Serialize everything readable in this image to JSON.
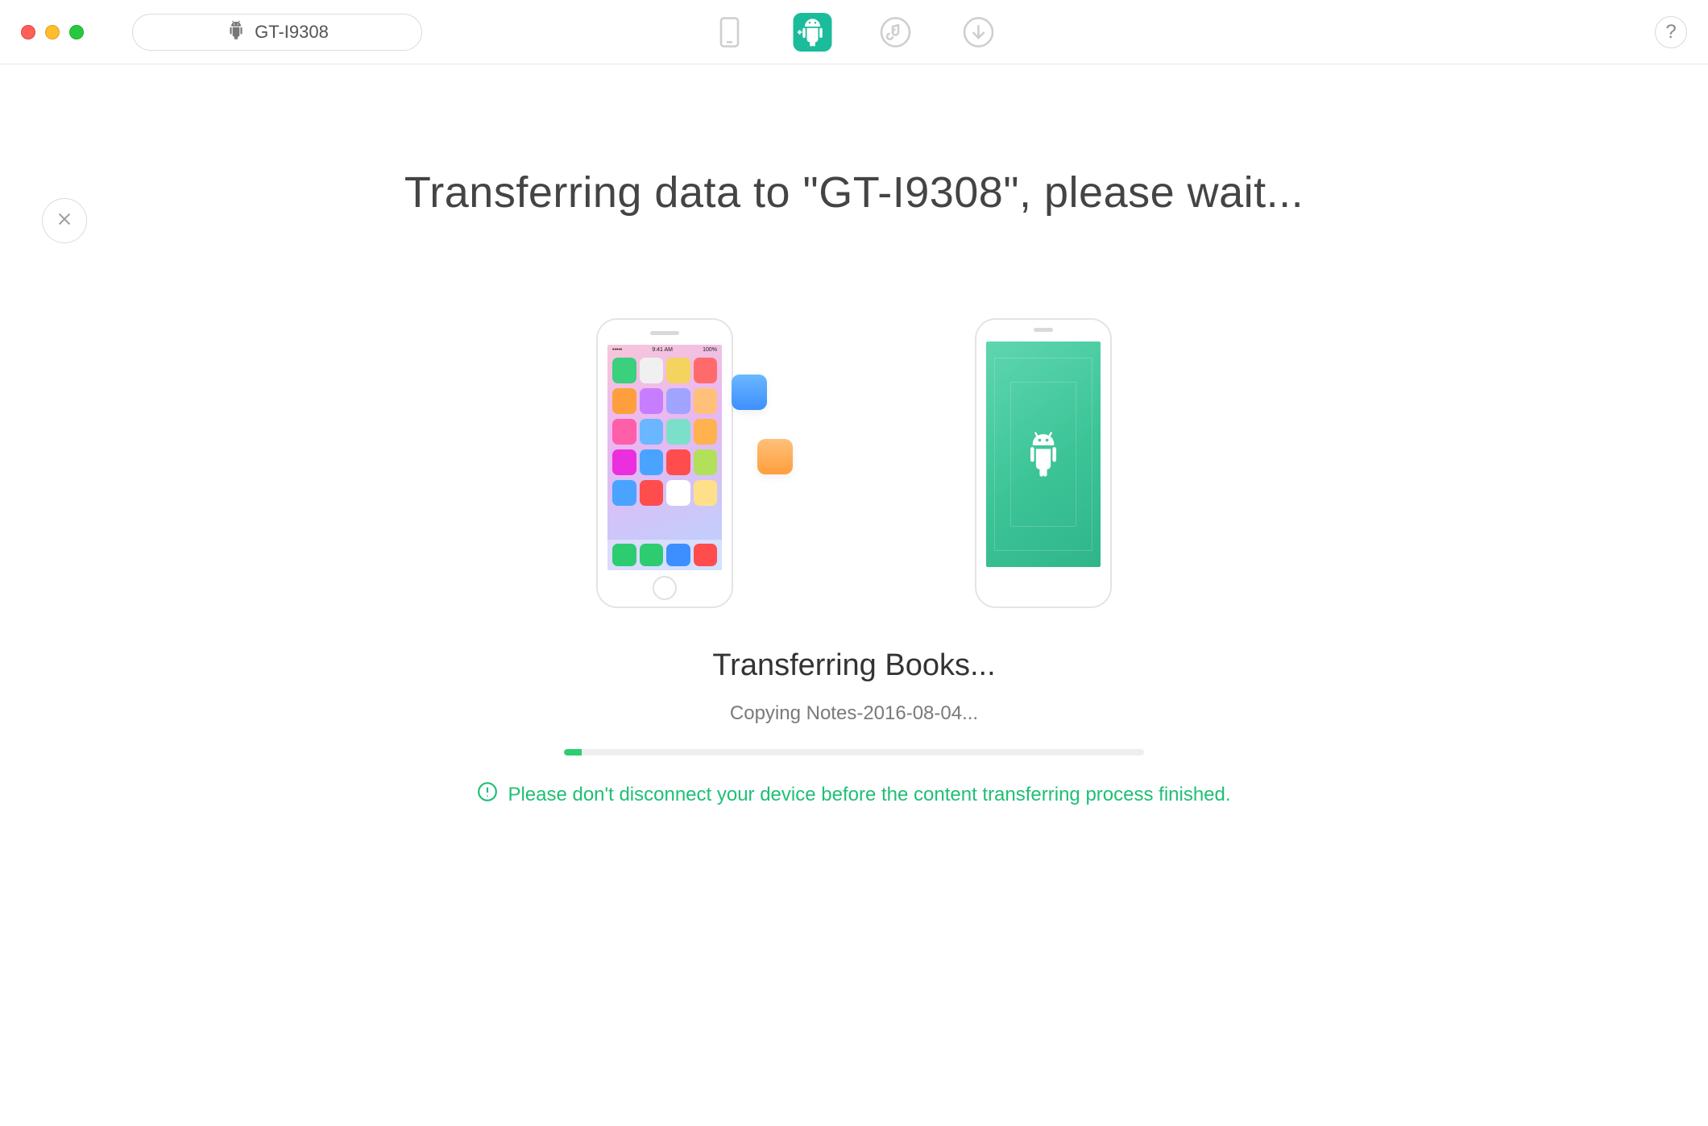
{
  "titlebar": {
    "device_name": "GT-I9308",
    "help_label": "?"
  },
  "tabs": {
    "phone": "phone-tab",
    "android_transfer": "android-transfer-tab",
    "music": "music-tab",
    "download": "download-tab",
    "active": "android-transfer-tab"
  },
  "main": {
    "title": "Transferring data to \"GT-I9308\", please wait..."
  },
  "status": {
    "title": "Transferring Books...",
    "subtitle": "Copying Notes-2016-08-04...",
    "progress_percent": 3
  },
  "warning": {
    "text": "Please don't disconnect your device before the content transferring process finished."
  },
  "ios_statusbar": {
    "left": "•••••",
    "center": "9:41 AM",
    "right": "100%"
  },
  "colors": {
    "accent_green": "#1bbc9b",
    "progress_green": "#2ecc71",
    "warning_green": "#1fbf75"
  },
  "ios_apps_row_colors": [
    [
      "#3ad07c",
      "#f0f0f0",
      "#f4d35e",
      "#ff6b6b"
    ],
    [
      "#ff9e3d",
      "#c77dff",
      "#a0a4ff",
      "#ffc07a"
    ],
    [
      "#ff5ea8",
      "#6bb7ff",
      "#7be0c9",
      "#ffb24d"
    ],
    [
      "#ec2fde",
      "#4aa3ff",
      "#ff4d4d",
      "#b3e05a"
    ],
    [
      "#4aa3ff",
      "#ff4d4d",
      "#ffffff",
      "#ffe08a"
    ]
  ],
  "ios_dock_colors": [
    "#2ecc71",
    "#2ecc71",
    "#3d8fff",
    "#ff4d4d"
  ]
}
